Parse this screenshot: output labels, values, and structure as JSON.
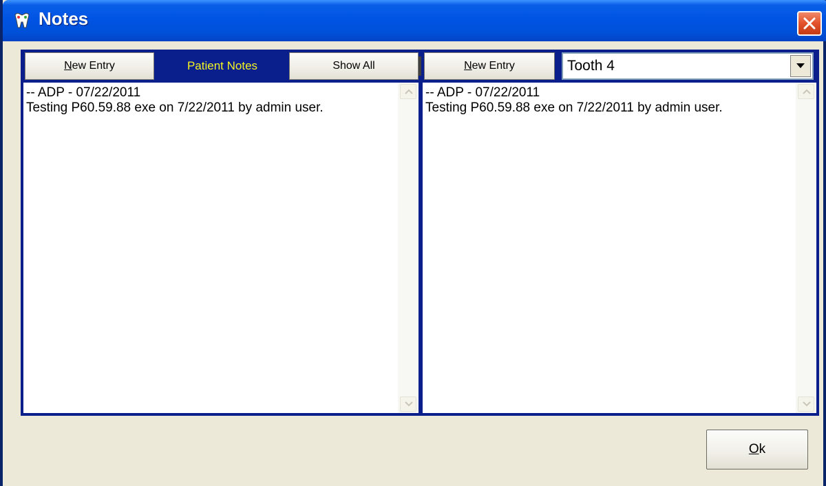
{
  "window": {
    "title": "Notes",
    "app_icon": "teeth-app-icon",
    "close_icon": "close-icon"
  },
  "left_panel": {
    "new_entry_prefix": "N",
    "new_entry_rest": "ew Entry",
    "header_label": "Patient Notes",
    "show_all_label": "Show All",
    "note_lines": [
      "-- ADP - 07/22/2011",
      "Testing P60.59.88 exe on 7/22/2011 by admin user."
    ]
  },
  "right_panel": {
    "new_entry_prefix": "N",
    "new_entry_rest": "ew Entry",
    "tooth_select_value": "Tooth  4",
    "note_lines": [
      "-- ADP - 07/22/2011",
      "Testing P60.59.88 exe on 7/22/2011 by admin user."
    ]
  },
  "footer": {
    "ok_prefix": "O",
    "ok_rest": "k"
  },
  "colors": {
    "title_bar": "#0054e3",
    "frame": "#0a1e8c",
    "header_label": "#f5f521",
    "close_button": "#e2512a"
  }
}
